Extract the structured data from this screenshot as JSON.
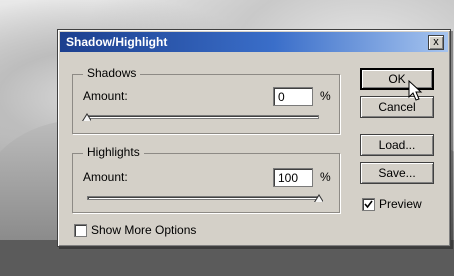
{
  "dialog": {
    "title": "Shadow/Highlight",
    "close_glyph": "x"
  },
  "shadows": {
    "legend": "Shadows",
    "amount_label": "Amount:",
    "amount_value": "0",
    "unit": "%",
    "slider_fraction": 0
  },
  "highlights": {
    "legend": "Highlights",
    "amount_label": "Amount:",
    "amount_value": "100",
    "unit": "%",
    "slider_fraction": 1.0
  },
  "buttons": {
    "ok": "OK",
    "cancel": "Cancel",
    "load": "Load...",
    "save": "Save..."
  },
  "options": {
    "preview_label": "Preview",
    "preview_checked": true,
    "more_options_label": "Show More Options",
    "more_options_checked": false
  },
  "colors": {
    "dialog_bg": "#d4d0c8",
    "title_start": "#1c3f8e",
    "title_end": "#a6c4ef"
  },
  "icons": {
    "cursor": "arrow-pointer-icon",
    "checkmark": "check-icon"
  }
}
